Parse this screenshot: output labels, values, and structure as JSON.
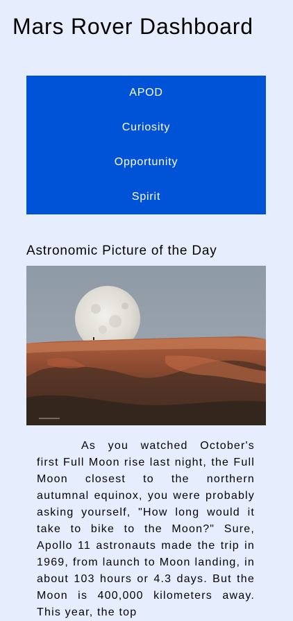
{
  "header": {
    "title": "Mars Rover Dashboard"
  },
  "nav": {
    "items": [
      {
        "label": "APOD"
      },
      {
        "label": "Curiosity"
      },
      {
        "label": "Opportunity"
      },
      {
        "label": "Spirit"
      }
    ],
    "colors": {
      "background": "#0052d6",
      "text": "#ffffff"
    }
  },
  "apod": {
    "heading": "Astronomic Picture of the Day",
    "image_subject": "moon-over-hill-photo",
    "description": "As you watched October's first Full Moon rise last night, the Full Moon closest to the northern autumnal equinox, you were probably asking yourself, \"How long would it take to bike to the Moon?\" Sure, Apollo 11 astronauts made the trip in 1969, from launch to Moon landing, in about 103 hours or 4.3 days. But the Moon is 400,000 kilometers away. This year, the top"
  },
  "theme": {
    "page_background": "#e6eefe"
  }
}
